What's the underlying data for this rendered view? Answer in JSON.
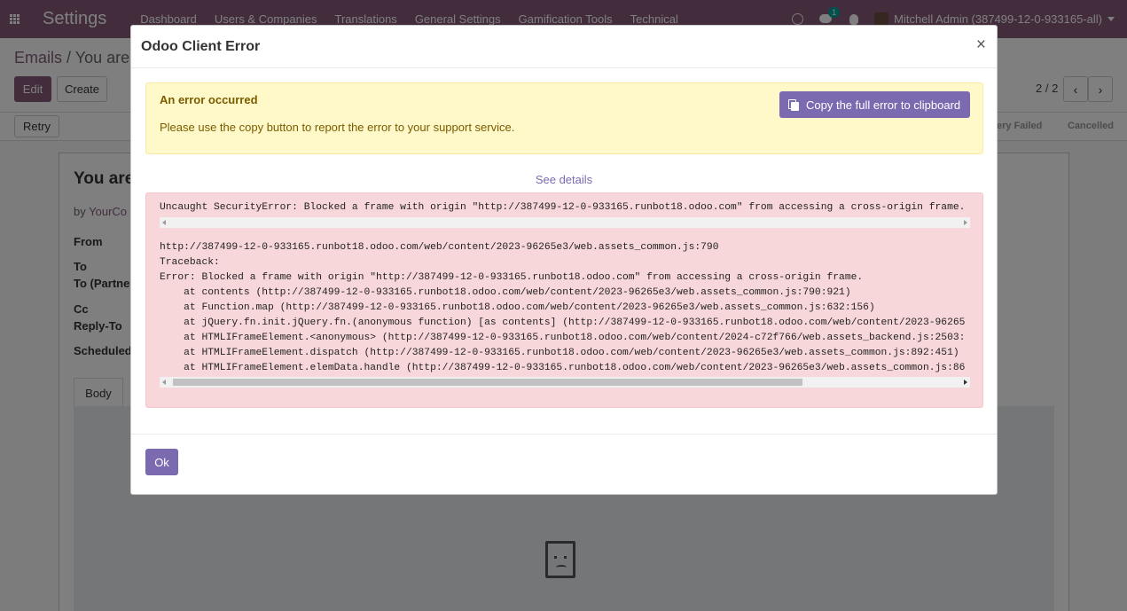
{
  "navbar": {
    "brand": "Settings",
    "menu": [
      "Dashboard",
      "Users & Companies",
      "Translations",
      "General Settings",
      "Gamification Tools",
      "Technical"
    ],
    "chat_badge": "1",
    "user_name": "Mitchell Admin (387499-12-0-933165-all)"
  },
  "control_panel": {
    "breadcrumb_parent": "Emails",
    "breadcrumb_sep": "/",
    "breadcrumb_current": "You are",
    "edit_label": "Edit",
    "create_label": "Create",
    "pager": "2 / 2",
    "prev_icon": "‹",
    "next_icon": "›"
  },
  "statusbar": {
    "retry_label": "Retry",
    "status_failed": "ery Failed",
    "status_cancelled": "Cancelled"
  },
  "form": {
    "title": "You are",
    "by_prefix": "by",
    "by_author": "YourCo",
    "labels": {
      "from": "From",
      "to": "To",
      "to_partners": "To (Partne",
      "cc": "Cc",
      "reply_to": "Reply-To",
      "scheduled": "Scheduled"
    },
    "tab_body": "Body"
  },
  "modal": {
    "title": "Odoo Client Error",
    "close": "×",
    "alert_title": "An error occurred",
    "alert_text": "Please use the copy button to report the error to your support service.",
    "copy_label": "Copy the full error to clipboard",
    "see_details": "See details",
    "error_message": "Uncaught SecurityError: Blocked a frame with origin \"http://387499-12-0-933165.runbot18.odoo.com\" from accessing a cross-origin frame.",
    "traceback": "http://387499-12-0-933165.runbot18.odoo.com/web/content/2023-96265e3/web.assets_common.js:790\nTraceback:\nError: Blocked a frame with origin \"http://387499-12-0-933165.runbot18.odoo.com\" from accessing a cross-origin frame.\n    at contents (http://387499-12-0-933165.runbot18.odoo.com/web/content/2023-96265e3/web.assets_common.js:790:921)\n    at Function.map (http://387499-12-0-933165.runbot18.odoo.com/web/content/2023-96265e3/web.assets_common.js:632:156)\n    at jQuery.fn.init.jQuery.fn.(anonymous function) [as contents] (http://387499-12-0-933165.runbot18.odoo.com/web/content/2023-96265\n    at HTMLIFrameElement.<anonymous> (http://387499-12-0-933165.runbot18.odoo.com/web/content/2024-c72f766/web.assets_backend.js:2503:\n    at HTMLIFrameElement.dispatch (http://387499-12-0-933165.runbot18.odoo.com/web/content/2023-96265e3/web.assets_common.js:892:451)\n    at HTMLIFrameElement.elemData.handle (http://387499-12-0-933165.runbot18.odoo.com/web/content/2023-96265e3/web.assets_common.js:86",
    "ok_label": "Ok"
  },
  "colors": {
    "navbar": "#875a7b",
    "modal_button": "#7c6ab0",
    "alert_bg": "#fff8c8",
    "error_bg": "#f8d7da"
  }
}
